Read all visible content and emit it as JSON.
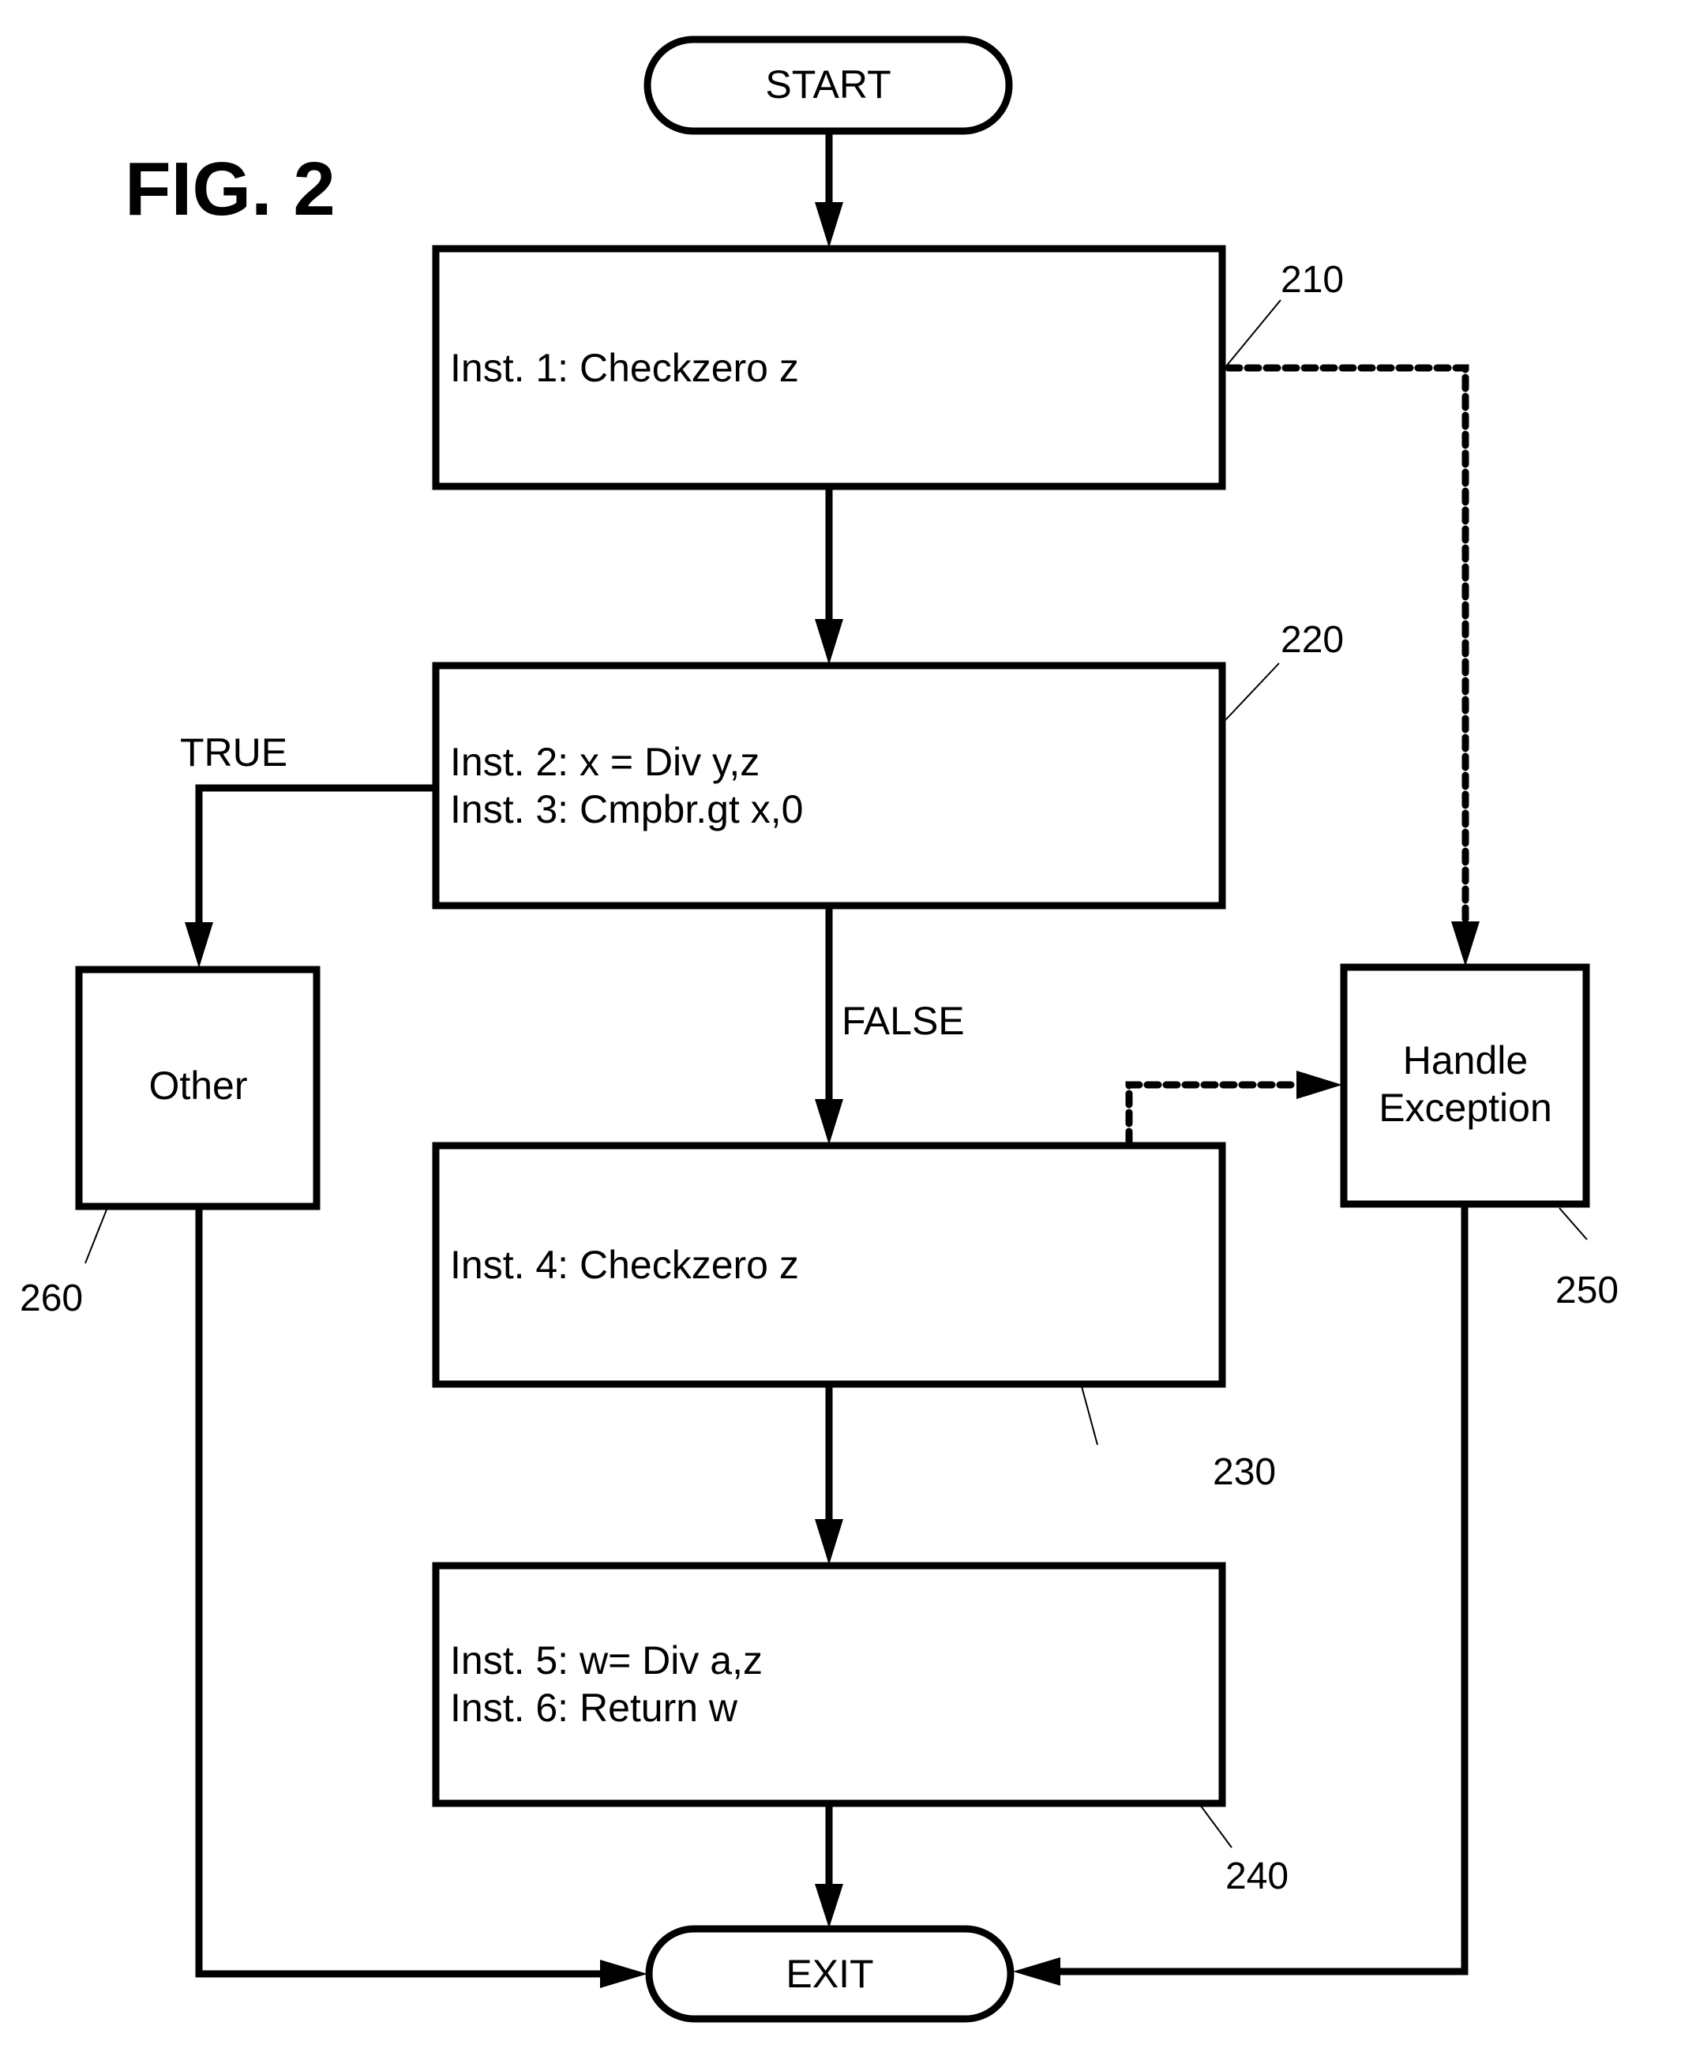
{
  "figure": {
    "title": "FIG. 2"
  },
  "terminals": {
    "start": "START",
    "exit": "EXIT"
  },
  "blocks": {
    "b210": {
      "ref": "210",
      "lines": [
        "Inst. 1: Checkzero z"
      ]
    },
    "b220": {
      "ref": "220",
      "lines": [
        "Inst. 2: x = Div y,z",
        "Inst. 3: Cmpbr.gt x,0"
      ]
    },
    "b230": {
      "ref": "230",
      "lines": [
        "Inst. 4: Checkzero z"
      ]
    },
    "b240": {
      "ref": "240",
      "lines": [
        "Inst. 5: w= Div a,z",
        "Inst. 6: Return w"
      ]
    },
    "b250": {
      "ref": "250",
      "lines": [
        "Handle",
        "Exception"
      ]
    },
    "b260": {
      "ref": "260",
      "lines": [
        "Other"
      ]
    }
  },
  "branches": {
    "true_label": "TRUE",
    "false_label": "FALSE"
  },
  "edges": [
    {
      "from": "START",
      "to": "210",
      "style": "solid"
    },
    {
      "from": "210",
      "to": "220",
      "style": "solid"
    },
    {
      "from": "220",
      "to": "260",
      "style": "solid",
      "label": "TRUE"
    },
    {
      "from": "220",
      "to": "230",
      "style": "solid",
      "label": "FALSE"
    },
    {
      "from": "230",
      "to": "240",
      "style": "solid"
    },
    {
      "from": "240",
      "to": "EXIT",
      "style": "solid"
    },
    {
      "from": "260",
      "to": "EXIT",
      "style": "solid"
    },
    {
      "from": "250",
      "to": "EXIT",
      "style": "solid"
    },
    {
      "from": "210",
      "to": "250",
      "style": "dotted"
    },
    {
      "from": "230",
      "to": "250",
      "style": "dotted"
    }
  ],
  "colors": {
    "ink": "#000000",
    "paper": "#ffffff"
  }
}
